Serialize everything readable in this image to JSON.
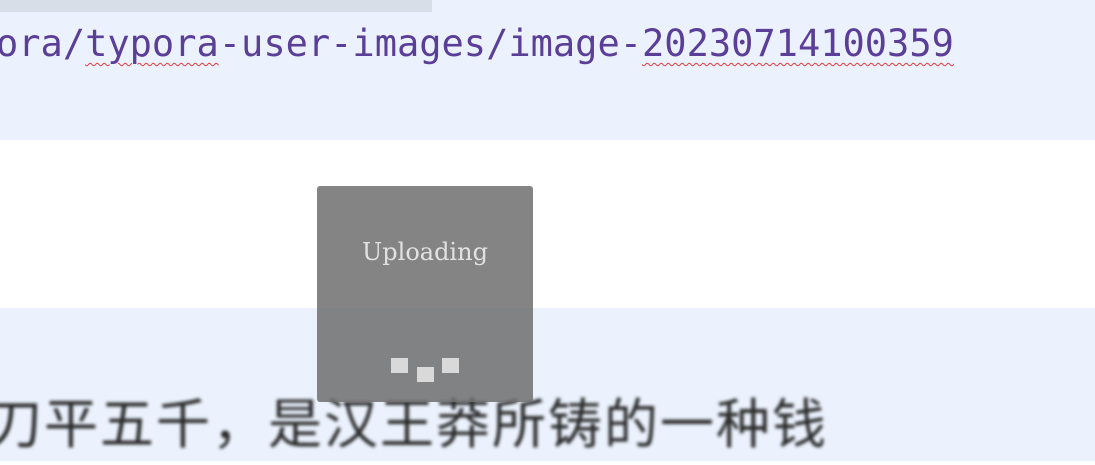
{
  "editor": {
    "path_segments": [
      {
        "text": "ora/",
        "misspelled": false
      },
      {
        "text": "typora",
        "misspelled": true
      },
      {
        "text": "-user-images/image-",
        "misspelled": false
      },
      {
        "text": "20230714100359",
        "misspelled": true
      }
    ],
    "body_text": "刀平五千，是汉王莽所铸的一种钱"
  },
  "upload_dialog": {
    "label": "Uploading",
    "spinner_icon": "loading-dots-icon"
  },
  "colors": {
    "code_text": "#5b3e97",
    "spell_error": "#e53935",
    "band_background": "#ebf2fd",
    "overlay": "#6e6e6e"
  }
}
